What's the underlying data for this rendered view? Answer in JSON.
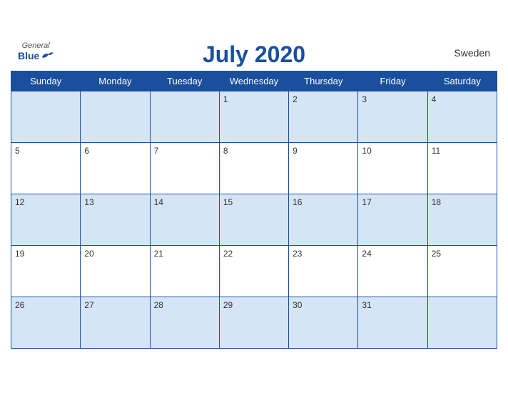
{
  "header": {
    "title": "July 2020",
    "country": "Sweden",
    "logo": {
      "general": "General",
      "blue": "Blue"
    }
  },
  "weekdays": [
    "Sunday",
    "Monday",
    "Tuesday",
    "Wednesday",
    "Thursday",
    "Friday",
    "Saturday"
  ],
  "weeks": [
    [
      null,
      null,
      null,
      1,
      2,
      3,
      4
    ],
    [
      5,
      6,
      7,
      8,
      9,
      10,
      11
    ],
    [
      12,
      13,
      14,
      15,
      16,
      17,
      18
    ],
    [
      19,
      20,
      21,
      22,
      23,
      24,
      25
    ],
    [
      26,
      27,
      28,
      29,
      30,
      31,
      null
    ]
  ],
  "colors": {
    "primary": "#1a4f9d",
    "row_odd": "#d6e4f7",
    "row_even": "#ffffff"
  }
}
